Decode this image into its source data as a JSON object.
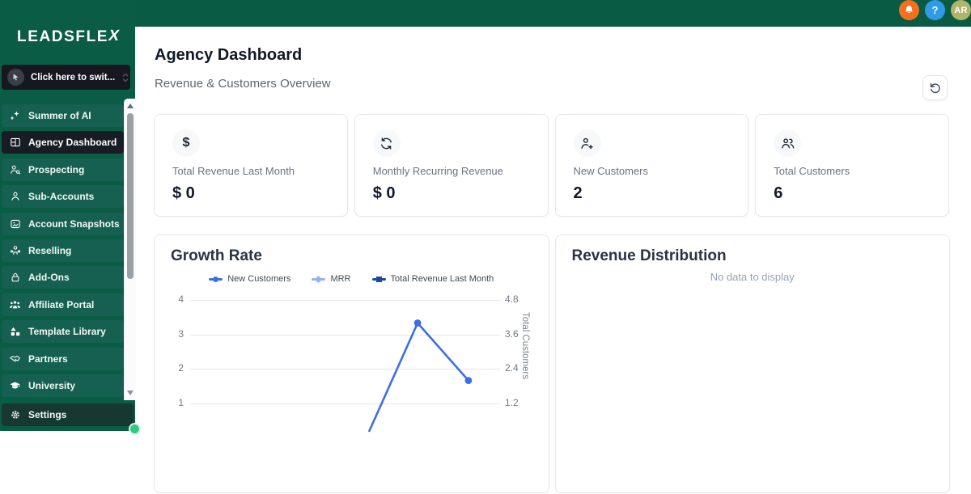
{
  "topbar": {
    "help_label": "?",
    "avatar_initials": "AR"
  },
  "sidebar": {
    "logo_text": "LEADSFLEX",
    "switcher_label": "Click here to swit...",
    "items": [
      {
        "label": "Summer of AI",
        "icon": "sparkles-icon",
        "active": false
      },
      {
        "label": "Agency Dashboard",
        "icon": "dashboard-icon",
        "active": true
      },
      {
        "label": "Prospecting",
        "icon": "person-search-icon",
        "active": false
      },
      {
        "label": "Sub-Accounts",
        "icon": "person-icon",
        "active": false
      },
      {
        "label": "Account Snapshots",
        "icon": "snapshot-icon",
        "active": false
      },
      {
        "label": "Reselling",
        "icon": "person-share-icon",
        "active": false
      },
      {
        "label": "Add-Ons",
        "icon": "lock-icon",
        "active": false
      },
      {
        "label": "Affiliate Portal",
        "icon": "people-group-icon",
        "active": false
      },
      {
        "label": "Template Library",
        "icon": "shapes-icon",
        "active": false
      },
      {
        "label": "Partners",
        "icon": "handshake-icon",
        "active": false
      },
      {
        "label": "University",
        "icon": "graduation-cap-icon",
        "active": false
      }
    ],
    "settings_label": "Settings"
  },
  "header": {
    "title": "Agency Dashboard",
    "subtitle": "Revenue & Customers Overview"
  },
  "stats": [
    {
      "icon": "dollar-icon",
      "label": "Total Revenue Last Month",
      "value": "$ 0"
    },
    {
      "icon": "recurring-icon",
      "label": "Monthly Recurring Revenue",
      "value": "$ 0"
    },
    {
      "icon": "person-plus-icon",
      "label": "New Customers",
      "value": "2"
    },
    {
      "icon": "people-icon",
      "label": "Total Customers",
      "value": "6"
    }
  ],
  "chart_data": {
    "type": "line",
    "title": "Growth Rate",
    "legend": [
      {
        "name": "New Customers",
        "color": "#3d6fe2",
        "marker": "circle"
      },
      {
        "name": "MRR",
        "color": "#8fb4f0",
        "marker": "diamond"
      },
      {
        "name": "Total Revenue Last Month",
        "color": "#1b4aa2",
        "marker": "square"
      }
    ],
    "left_axis_ticks": [
      4,
      3,
      2,
      1
    ],
    "right_axis_ticks": [
      4.8,
      3.6,
      2.4,
      1.2
    ],
    "right_axis_label": "Total Customers",
    "grid": true,
    "legend_position": "top",
    "visible_series": {
      "name": "New Customers",
      "color": "#3d6fe2",
      "axis": "right",
      "points": [
        {
          "x_frac": 0.577,
          "value": 0.22,
          "marker": false
        },
        {
          "x_frac": 0.734,
          "value": 4.0,
          "marker": true
        },
        {
          "x_frac": 0.898,
          "value": 2.0,
          "marker": true
        }
      ]
    }
  },
  "revenue_distribution": {
    "title": "Revenue Distribution",
    "empty_text": "No data to display"
  },
  "colors": {
    "brand_green": "#0b5c45",
    "active_item_bg": "#181c24",
    "notification_orange": "#f4701d",
    "help_blue": "#2d9be5",
    "avatar_olive": "#b0b46b",
    "chart_blue": "#3d6fe2",
    "chart_blue_light": "#8fb4f0",
    "chart_blue_dark": "#1b4aa2"
  }
}
